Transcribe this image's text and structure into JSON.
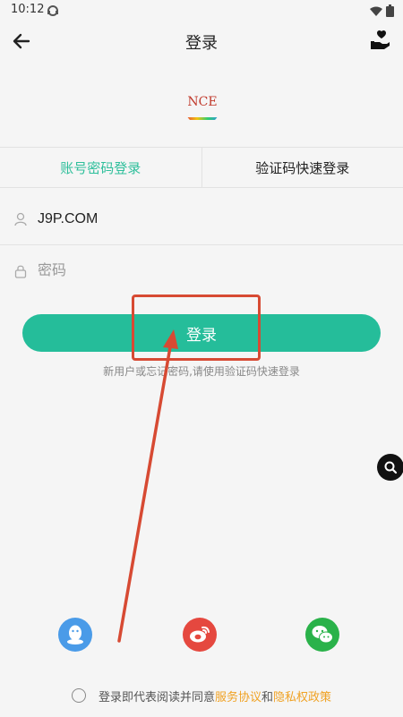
{
  "status": {
    "time": "10:12"
  },
  "header": {
    "title": "登录"
  },
  "logo": {
    "text": "NCE"
  },
  "tabs": [
    {
      "label": "账号密码登录",
      "active": true
    },
    {
      "label": "验证码快速登录",
      "active": false
    }
  ],
  "form": {
    "account": {
      "value": "J9P.COM"
    },
    "password": {
      "placeholder": "密码"
    }
  },
  "login_button": {
    "label": "登录"
  },
  "hint": "新用户或忘记密码,请使用验证码快速登录",
  "social": [
    "qq-login",
    "weibo-login",
    "wechat-login"
  ],
  "agreement": {
    "prefix": "登录即代表阅读并同意",
    "terms": "服务协议",
    "and": "和",
    "privacy": "隐私权政策"
  },
  "colors": {
    "accent": "#25bd9a",
    "link": "#f0a224",
    "annotation": "#d74a33"
  }
}
